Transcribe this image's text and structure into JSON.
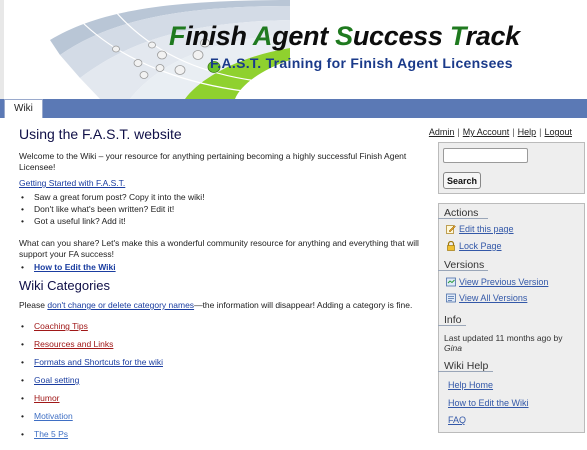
{
  "banner": {
    "title_parts": [
      "Finish ",
      "A",
      "gent ",
      "S",
      "uccess ",
      "T",
      "rack"
    ],
    "title_f": "F",
    "subtitle": "F.A.S.T. Training for Finish Agent Licensees"
  },
  "tabs": [
    {
      "label": "Wiki"
    }
  ],
  "page": {
    "title": "Using the F.A.S.T. website",
    "intro": "Welcome to the Wiki – your resource for anything pertaining becoming a highly successful Finish Agent Licensee!",
    "getting_started": "Getting Started with F.A.S.T.",
    "getting_started_items": [
      "Saw a great forum post? Copy it into the wiki!",
      "Don't like what's been written? Edit it!",
      "Got a useful link? Add it!"
    ],
    "share": "What can you share? Let's make this a wonderful community resource for anything and everything that will support your FA success!",
    "how_to_edit": "How to Edit the Wiki",
    "categories_heading": "Wiki Categories",
    "categories_note_pre": "Please ",
    "categories_note_link": "don't change or delete category names",
    "categories_note_post": "—the information will disappear! Adding a category is fine.",
    "categories": [
      {
        "label": "Coaching Tips",
        "color": "#a01818"
      },
      {
        "label": "Resources and Links",
        "color": "#a01818"
      },
      {
        "label": "Formats and Shortcuts for the wiki",
        "color": "#1a3da0"
      },
      {
        "label": "Goal setting",
        "color": "#1a3da0"
      },
      {
        "label": "Humor",
        "color": "#a01818"
      },
      {
        "label": "Motivation",
        "color": "#3f6fc4"
      },
      {
        "label": "The 5 Ps",
        "color": "#3f6fc4"
      }
    ]
  },
  "usernav": {
    "admin": "Admin",
    "my_account": "My Account",
    "help": "Help",
    "logout": "Logout"
  },
  "search": {
    "button": "Search",
    "value": ""
  },
  "sidebar": {
    "actions_heading": "Actions",
    "edit_page": "Edit this page",
    "lock_page": "Lock Page",
    "versions_heading": "Versions",
    "view_previous": "View Previous Version",
    "view_all": "View All Versions",
    "info_heading": "Info",
    "info_updated": "Last updated 11 months ago by",
    "info_author": "Gina",
    "help_heading": "Wiki Help",
    "help_home": "Help Home",
    "help_edit": "How to Edit the Wiki",
    "help_faq": "FAQ"
  },
  "colors": {
    "accent_bar": "#5b79b5",
    "link": "#3358a8",
    "brand_green": "#1f7a1f"
  }
}
